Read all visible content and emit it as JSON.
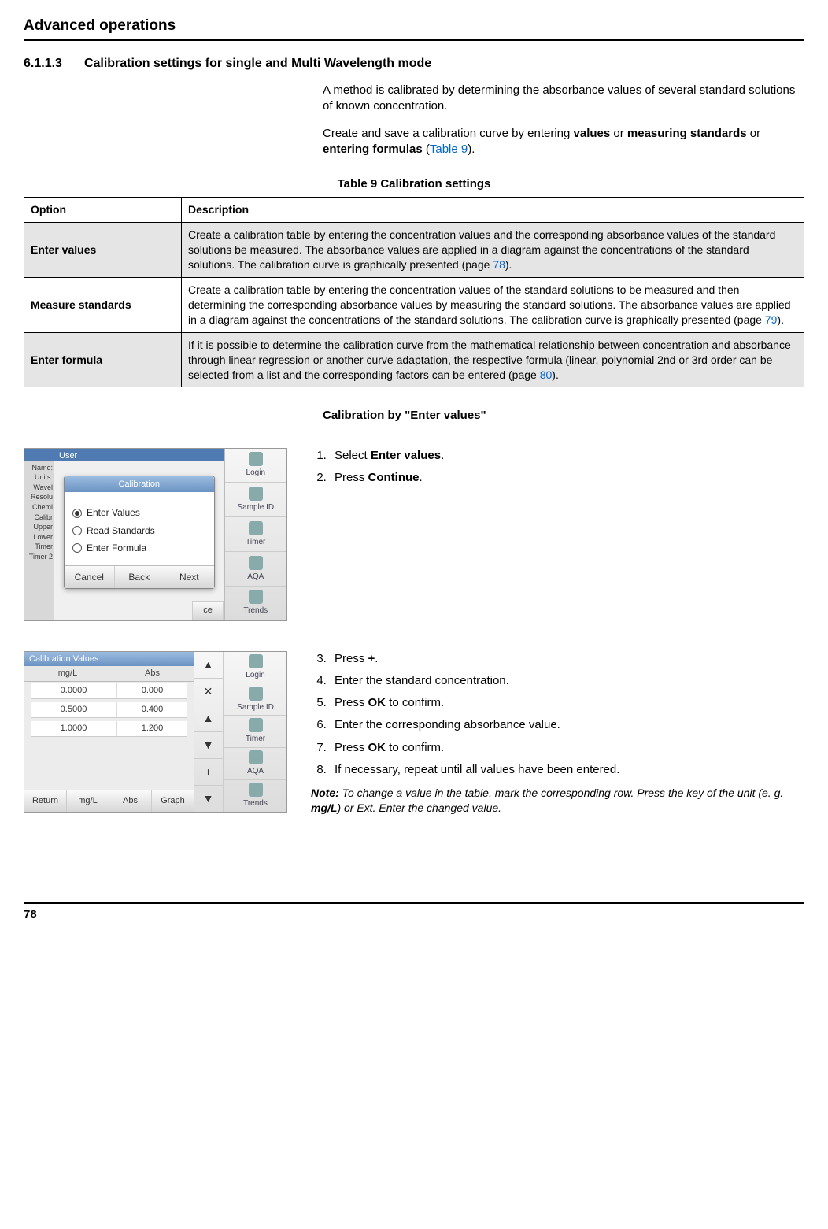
{
  "header": {
    "title": "Advanced operations"
  },
  "subsection": {
    "number": "6.1.1.3",
    "title": "Calibration settings for single and Multi Wavelength mode"
  },
  "intro": {
    "p1": "A method is calibrated by determining the absorbance values of several standard solutions of known concentration.",
    "p2a": "Create and save a calibration curve by entering ",
    "p2_values": "values",
    "p2_or": " or ",
    "p2_meas": "measuring standards",
    "p2_or2": "  or ",
    "p2_formula": "entering formulas",
    "p2_open": " (",
    "p2_link": "Table 9",
    "p2_close": ")."
  },
  "table": {
    "caption": "Table 9 Calibration settings",
    "col1": "Option",
    "col2": "Description",
    "rows": [
      {
        "option": "Enter values",
        "desc_a": "Create a calibration table by entering the concentration values and the corresponding absorbance values of the standard solutions be measured. The absorbance values are applied in a diagram against the concentrations of the standard solutions. The calibration curve is graphically presented (page ",
        "page": "78",
        "desc_b": ")."
      },
      {
        "option": "Measure standards",
        "desc_a": "Create a calibration table by entering the concentration values of the standard solutions to be measured and then determining the corresponding absorbance values by measuring the standard solutions. The absorbance values are applied in a diagram against the concentrations of the standard solutions. The calibration curve is graphically presented (page ",
        "page": "79",
        "desc_b": ")."
      },
      {
        "option": "Enter formula",
        "desc_a": "If it is possible to determine the calibration curve from the mathematical relationship between concentration and absorbance through linear regression or another curve adaptation, the respective formula (linear, polynomial 2nd or 3rd order can be selected from a list and the corresponding factors can be entered (page ",
        "page": "80",
        "desc_b": ")."
      }
    ]
  },
  "calib_header": "Calibration by \"Enter values\"",
  "shot1": {
    "top": "User",
    "dialog_title": "Calibration",
    "radios": [
      "Enter Values",
      "Read Standards",
      "Enter Formula"
    ],
    "buttons": [
      "Cancel",
      "Back",
      "Next"
    ],
    "sidebar": [
      "Login",
      "Sample ID",
      "Timer",
      "AQA",
      "Trends"
    ],
    "leftLabels": [
      "Name:",
      "Units:",
      "Wavel",
      "Resolu",
      "Chemi",
      "Calibr",
      "Upper",
      "Lower",
      "Timer",
      "Timer 2"
    ],
    "cornerBtn": "ce"
  },
  "steps1": {
    "s1a": "Select ",
    "s1b": "Enter values",
    "s1c": ".",
    "s2a": "Press ",
    "s2b": "Continue",
    "s2c": "."
  },
  "shot2": {
    "title": "Calibration Values",
    "h1": "mg/L",
    "h2": "Abs",
    "rows": [
      {
        "c": "0.0000",
        "a": "0.000"
      },
      {
        "c": "0.5000",
        "a": "0.400"
      },
      {
        "c": "1.0000",
        "a": "1.200"
      }
    ],
    "nav": [
      "▲",
      "✕",
      "▲",
      "▼",
      "+",
      "▼"
    ],
    "bottom": [
      "Return",
      "mg/L",
      "Abs",
      "Graph"
    ],
    "sidebar": [
      "Login",
      "Sample ID",
      "Timer",
      "AQA",
      "Trends"
    ]
  },
  "steps2": {
    "s3a": "Press ",
    "s3b": "+",
    "s3c": ".",
    "s4": "Enter the standard concentration.",
    "s5a": "Press ",
    "s5b": "OK",
    "s5c": " to confirm.",
    "s6": "Enter the corresponding absorbance value.",
    "s7a": "Press ",
    "s7b": "OK",
    "s7c": " to confirm.",
    "s8": "If necessary, repeat until all values have been entered.",
    "note_label": "Note:",
    "note_a": " To change a value in the table, mark the corresponding row. Press the key of the unit (e. g. ",
    "note_b": "mg/L",
    "note_c": ") or ",
    "note_d": "Ext",
    "note_e": ". Enter the changed value."
  },
  "footer": {
    "page": "78"
  }
}
